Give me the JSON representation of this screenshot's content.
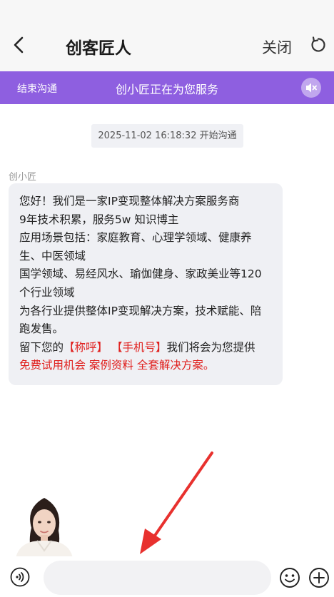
{
  "header": {
    "title": "创客匠人",
    "close_label": "关闭"
  },
  "banner": {
    "end_label": "结束沟通",
    "status_text": "创小匠正在为您服务"
  },
  "chat": {
    "timestamp": "2025-11-02 16:18:32 开始沟通",
    "sender_name": "创小匠",
    "message": {
      "line1": "您好！我们是一家IP变现整体解决方案服务商",
      "line2": "9年技术积累，服务5w 知识博主",
      "line3": "应用场景包括：家庭教育、心理学领域、健康养",
      "line4": "生、中医领域",
      "line5": "国学领域、易经风水、瑜伽健身、家政美业等120",
      "line6": "个行业领域",
      "line7": "为各行业提供整体IP变现解决方案，技术赋能、陪",
      "line8": "跑发售。",
      "line9_prefix": "留下您的",
      "line9_name": "【称呼】",
      "line9_gap": " ",
      "line9_phone": "【手机号】",
      "line9_suffix": "我们将会为您提供",
      "line10": "免费试用机会 案例资料 全套解决方案。"
    }
  },
  "input": {
    "value": "",
    "placeholder": ""
  },
  "colors": {
    "banner": "#8e5fe0",
    "highlight": "#e0201e",
    "arrow": "#e8312e"
  }
}
